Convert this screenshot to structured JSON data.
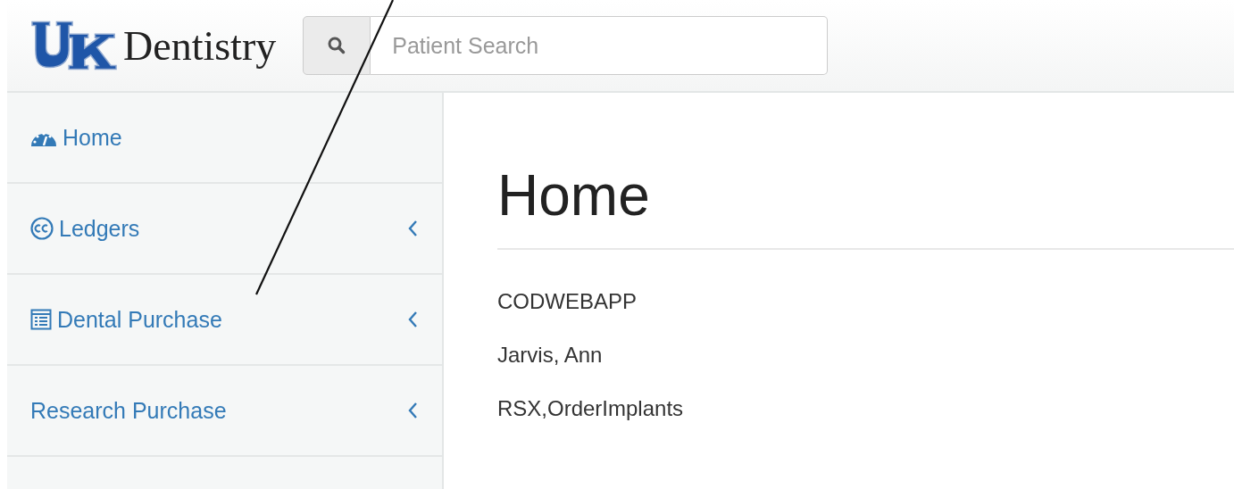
{
  "header": {
    "logo_text": "Dentistry",
    "search": {
      "placeholder": "Patient Search"
    }
  },
  "sidebar": {
    "items": [
      {
        "label": "Home",
        "kind": "dashboard",
        "expandable": false
      },
      {
        "label": "Ledgers",
        "kind": "cc",
        "expandable": true
      },
      {
        "label": "Dental Purchase",
        "kind": "list",
        "expandable": true
      },
      {
        "label": "Research Purchase",
        "kind": "plain",
        "expandable": true
      }
    ]
  },
  "content": {
    "title": "Home",
    "lines": [
      "CODWEBAPP",
      "Jarvis, Ann",
      "RSX,OrderImplants"
    ]
  }
}
